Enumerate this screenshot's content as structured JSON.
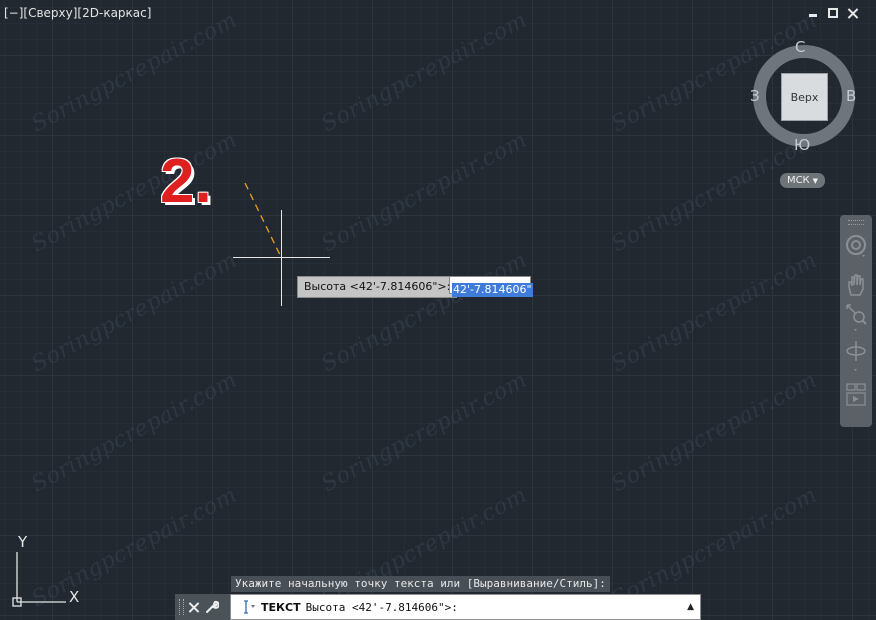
{
  "viewport": {
    "label": "[−][Сверху][2D-каркас]"
  },
  "window_controls": [
    "minimize-icon",
    "maximize-icon",
    "close-icon"
  ],
  "viewcube": {
    "face": "Верх",
    "north": "С",
    "south": "Ю",
    "west": "З",
    "east": "В",
    "wcs": "МСК"
  },
  "navbar": {
    "tools": [
      "steering-wheel-icon",
      "pan-hand-icon",
      "zoom-icon",
      "orbit-icon",
      "showmotion-icon"
    ]
  },
  "annotation": {
    "step_number": "2."
  },
  "dynamic_input": {
    "prompt": "Высота <42'-7.814606\">:",
    "value": "42'-7.814606\""
  },
  "watermark": "Soringpcrepair.com",
  "command": {
    "history_line": "Укажите начальную точку текста или [Выравнивание/Стиль]:",
    "name": "ТЕКСТ",
    "prompt": "Высота <42'-7.814606\">:"
  },
  "ucs": {
    "x_label": "X",
    "y_label": "Y"
  },
  "colors": {
    "background": "#212830",
    "rubberband": "#e6a020",
    "annotation_red": "#e0201f",
    "input_highlight": "#3f7bd9"
  }
}
